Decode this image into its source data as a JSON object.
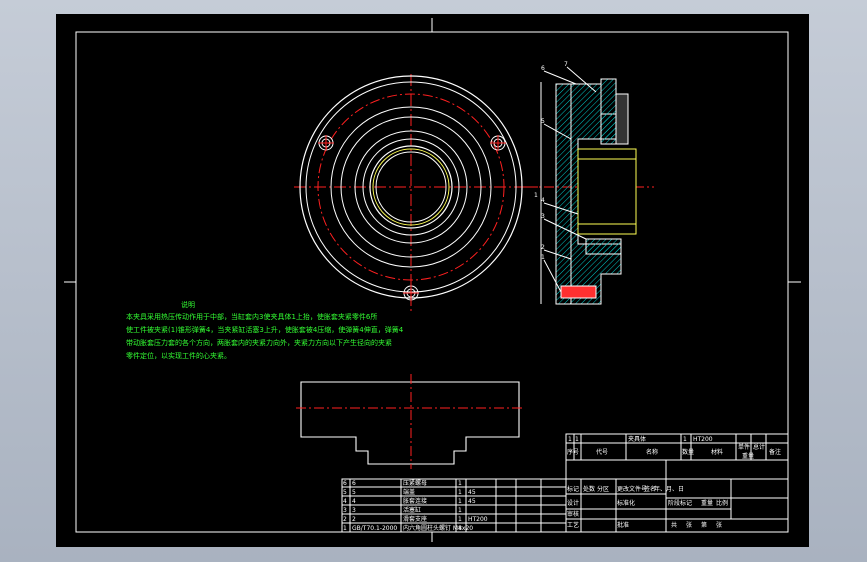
{
  "notes": {
    "title": "说明",
    "lines": [
      "本夹具采用热压传动作用于中部，当缸套内3使夹具体1上抬，使胀套夹紧零件6所",
      "使工件被夹紧(1)锥形弹簧4，当夹紧缸活塞3上升，使胀套被4压缩，使弹簧4伸直，弹簧4",
      "带动胀套压力套的各个方向，两胀套内的夹紧力向外，夹紧力方向以下产生径向的夹紧",
      "零件定位，以实现工件的心夹紧。"
    ]
  },
  "balloons": [
    "6",
    "7",
    "5",
    "1",
    "4",
    "3",
    "2",
    "1"
  ],
  "upper_table": {
    "row1": [
      "1",
      "1",
      "夹具体",
      "1",
      "HT200"
    ],
    "header": [
      "序号",
      "代号",
      "名称",
      "数量",
      "材料",
      "单件",
      "总计",
      "备注"
    ],
    "weight": "重量"
  },
  "parts_list": [
    [
      "6",
      "6",
      "压紧螺母",
      "1",
      ""
    ],
    [
      "5",
      "5",
      "端盖",
      "1",
      "45"
    ],
    [
      "4",
      "4",
      "胀套连接",
      "1",
      "45"
    ],
    [
      "3",
      "3",
      "活塞缸",
      "1",
      ""
    ],
    [
      "2",
      "2",
      "滑套支座",
      "1",
      "HT200"
    ],
    [
      "1",
      "GB/T70.1-2000",
      "内六角圆柱头螺钉 M8x20",
      "4",
      ""
    ]
  ],
  "title_block": {
    "row_a": [
      "标记",
      "处数",
      "分区",
      "更改文件号",
      "签名",
      "年、月、日"
    ],
    "row_b": [
      "设计",
      "标准化"
    ],
    "row_c": [
      "审核"
    ],
    "row_d": [
      "工艺",
      "批准"
    ],
    "stage": [
      "阶段标记",
      "重量",
      "比例"
    ],
    "sheet": [
      "共",
      "张",
      "第",
      "张"
    ]
  },
  "colors": {
    "border": "#ffffff",
    "center_line": "#ff2020",
    "inner_part": "#ffff55",
    "section": "#00e0e0",
    "notes_text": "#33ff33"
  }
}
